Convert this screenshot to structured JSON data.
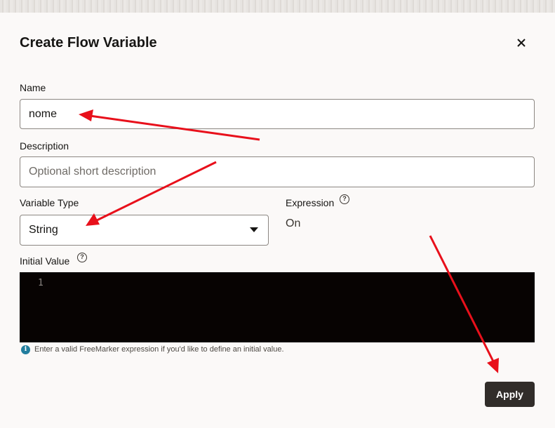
{
  "dialog": {
    "title": "Create Flow Variable",
    "close_icon": "close-icon"
  },
  "fields": {
    "name": {
      "label": "Name",
      "value": "nome"
    },
    "description": {
      "label": "Description",
      "value": "",
      "placeholder": "Optional short description"
    },
    "variable_type": {
      "label": "Variable Type",
      "selected": "String"
    },
    "expression": {
      "label": "Expression",
      "value": "On",
      "help_icon": "question-circle-icon"
    },
    "initial_value": {
      "label": "Initial Value",
      "help_icon": "question-circle-icon",
      "line_number": "1",
      "hint": "Enter a valid FreeMarker expression if you'd like to define an initial value."
    }
  },
  "footer": {
    "apply_label": "Apply"
  },
  "colors": {
    "background": "#fbf9f8",
    "editor_background": "#070302",
    "primary_button": "#312d2a",
    "annotation_arrow": "#e8101b",
    "info_icon": "#227e9e"
  }
}
